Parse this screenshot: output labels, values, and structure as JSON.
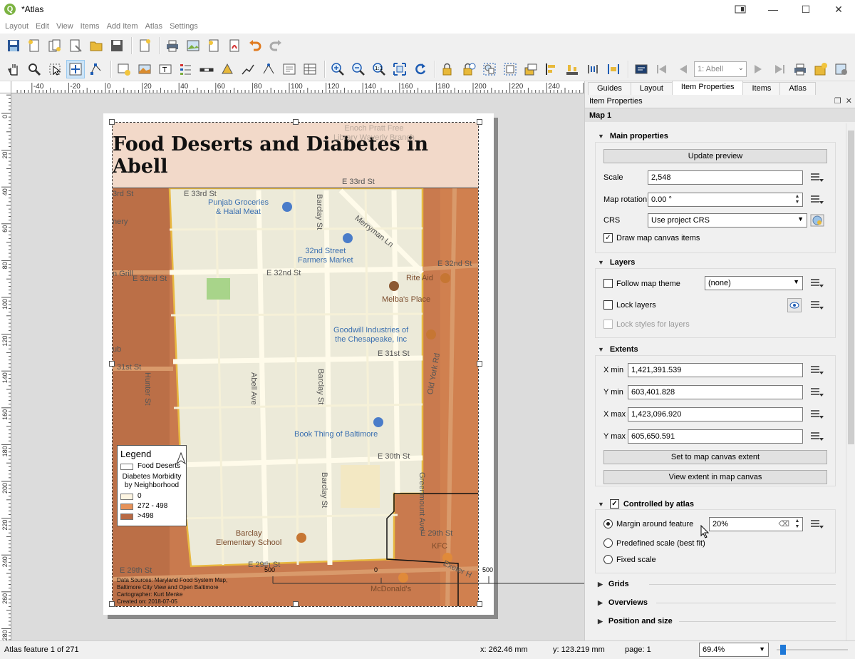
{
  "window": {
    "title": "*Atlas",
    "logo_text": "Q",
    "minimize": "—",
    "maximize": "☐",
    "close": "✕"
  },
  "menu": [
    "Layout",
    "Edit",
    "View",
    "Items",
    "Add Item",
    "Atlas",
    "Settings"
  ],
  "atlas_nav": {
    "current_feature": "1: Abell"
  },
  "ruler_h": [
    -40,
    -20,
    0,
    20,
    40,
    60,
    80,
    100,
    120,
    140,
    160,
    180,
    200,
    220,
    240,
    260
  ],
  "ruler_v": [
    0,
    20,
    40,
    60,
    80,
    100,
    120,
    140,
    160,
    180,
    200,
    220,
    240,
    260,
    280
  ],
  "map": {
    "title": "Food Deserts and Diabetes in Abell",
    "streets": [
      "E 33rd St",
      "E 33rd St",
      "E 32nd St",
      "E 32nd St",
      "E 32nd St",
      "E 31st St",
      "31st St",
      "E 30th St",
      "E 29th St",
      "E 29th St",
      "E 29th St",
      "Abell Ave",
      "Barclay St",
      "Barclay St",
      "Barclay St",
      "Merryman Ln",
      "Old York Rd",
      "Greenmount Ave",
      "Hunter St",
      "Exeter H",
      "3rd St",
      "nery",
      "n Grill",
      "ub"
    ],
    "pois": [
      "Punjab Groceries\n& Halal Meat",
      "32nd Street\nFarmers Market",
      "Rite Aid",
      "Melba's Place",
      "Goodwill Industries of\nthe Chesapeake, Inc",
      "Book Thing of Baltimore",
      "Barclay\nElementary School",
      "KFC",
      "McDonald's",
      "Enoch Pratt Free\nLibrary Waverly Branch"
    ],
    "legend": {
      "title": "Legend",
      "food_deserts": "Food Deserts",
      "diabetes_title": "Diabetes Morbidity\nby Neighborhood",
      "classes": [
        {
          "label": "0",
          "color": "#fdf5e2"
        },
        {
          "label": "272 - 498",
          "color": "#e6925a"
        },
        {
          "label": ">498",
          "color": "#b86a45"
        }
      ]
    },
    "credits": [
      "Data Sources: Maryland Food System Map,",
      "Baltimore City View and Open Baltimore",
      "Cartographer: Kurt Menke",
      "Created on: 2018-07-05"
    ],
    "scale_labels": [
      "500",
      "0",
      "500"
    ]
  },
  "dock": {
    "tabs": [
      "Guides",
      "Layout",
      "Item Properties",
      "Items",
      "Atlas"
    ],
    "header": "Item Properties",
    "item_name": "Map 1",
    "main": {
      "title": "Main properties",
      "update_preview": "Update preview",
      "scale_label": "Scale",
      "scale_value": "2,548",
      "rotation_label": "Map rotation",
      "rotation_value": "0.00 °",
      "crs_label": "CRS",
      "crs_value": "Use project CRS",
      "draw_items_label": "Draw map canvas items"
    },
    "layers": {
      "title": "Layers",
      "follow_theme_label": "Follow map theme",
      "follow_theme_value": "(none)",
      "lock_layers_label": "Lock layers",
      "lock_styles_label": "Lock styles for layers"
    },
    "extents": {
      "title": "Extents",
      "xmin_label": "X min",
      "xmin": "1,421,391.539",
      "ymin_label": "Y min",
      "ymin": "603,401.828",
      "xmax_label": "X max",
      "xmax": "1,423,096.920",
      "ymax_label": "Y max",
      "ymax": "605,650.591",
      "set_extent": "Set to map canvas extent",
      "view_extent": "View extent in map canvas"
    },
    "atlas": {
      "title": "Controlled by atlas",
      "margin_label": "Margin around feature",
      "margin_value": "20%",
      "predefined_label": "Predefined scale (best fit)",
      "fixed_label": "Fixed scale"
    },
    "collapsed": [
      "Grids",
      "Overviews",
      "Position and size"
    ]
  },
  "status": {
    "atlas_feature": "Atlas feature 1 of 271",
    "x": "x: 262.46 mm",
    "y": "y: 123.219 mm",
    "page": "page: 1",
    "zoom": "69.4%",
    "zoom_fraction": 0.05
  }
}
